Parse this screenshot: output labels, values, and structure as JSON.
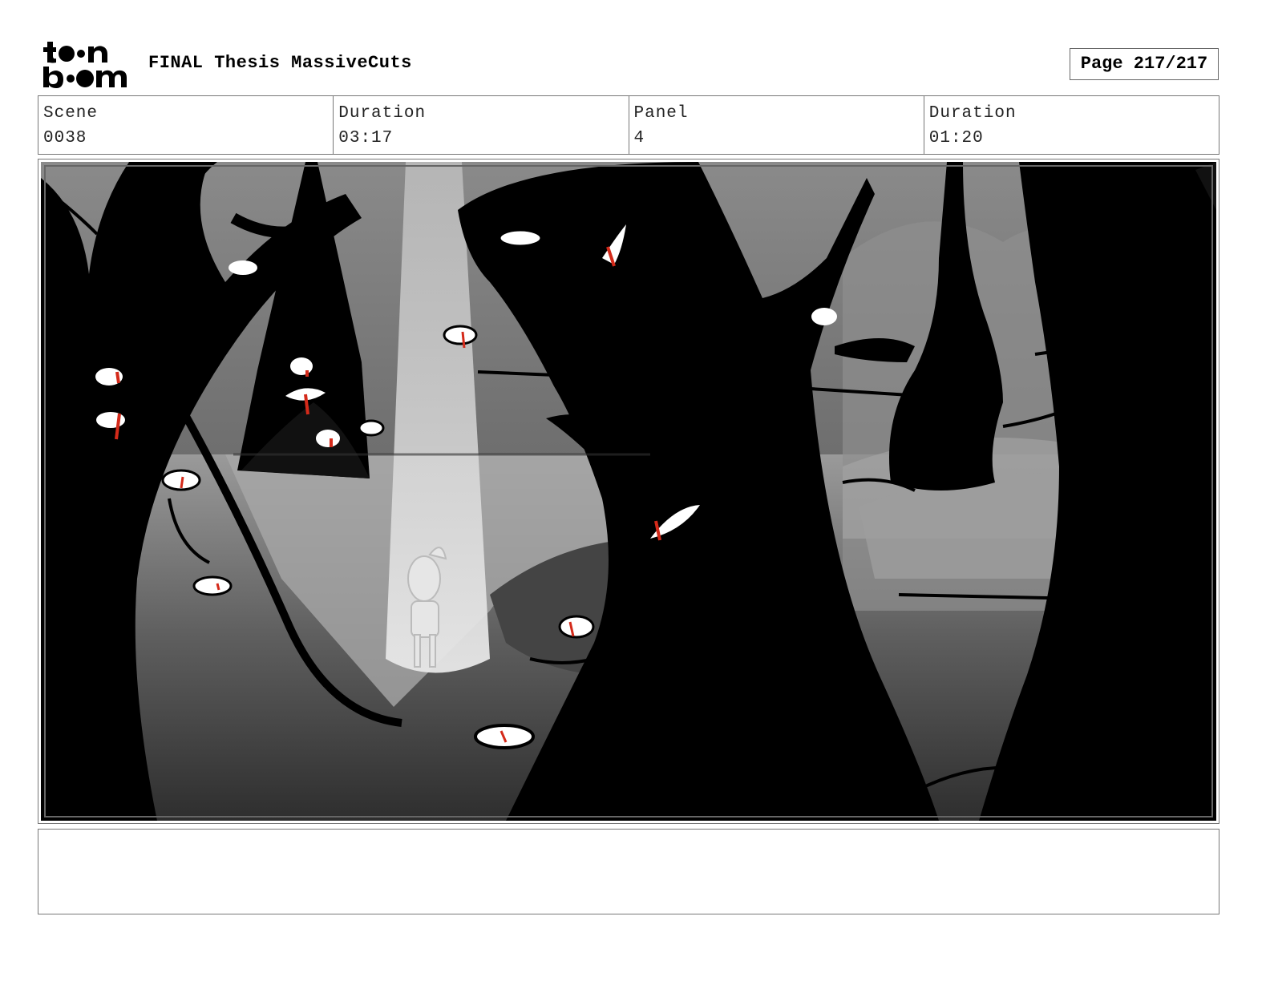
{
  "header": {
    "logo_text": "toonboom",
    "title": "FINAL Thesis MassiveCuts",
    "page_label": "Page 217/217"
  },
  "info": {
    "scene_label": "Scene",
    "scene_value": "0038",
    "scene_duration_label": "Duration",
    "scene_duration_value": "03:17",
    "panel_label": "Panel",
    "panel_value": "4",
    "panel_duration_label": "Duration",
    "panel_duration_value": "01:20"
  },
  "notes": {
    "text": ""
  },
  "colors": {
    "accent_red": "#d42a1a",
    "ink": "#000000",
    "border": "#777777"
  }
}
